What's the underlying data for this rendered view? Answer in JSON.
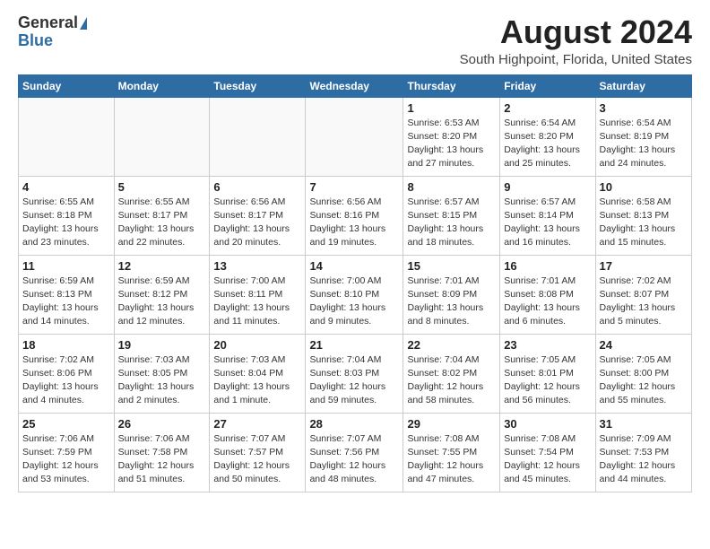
{
  "header": {
    "logo_general": "General",
    "logo_blue": "Blue",
    "title": "August 2024",
    "subtitle": "South Highpoint, Florida, United States"
  },
  "days_of_week": [
    "Sunday",
    "Monday",
    "Tuesday",
    "Wednesday",
    "Thursday",
    "Friday",
    "Saturday"
  ],
  "weeks": [
    [
      {
        "day": "",
        "info": ""
      },
      {
        "day": "",
        "info": ""
      },
      {
        "day": "",
        "info": ""
      },
      {
        "day": "",
        "info": ""
      },
      {
        "day": "1",
        "info": "Sunrise: 6:53 AM\nSunset: 8:20 PM\nDaylight: 13 hours\nand 27 minutes."
      },
      {
        "day": "2",
        "info": "Sunrise: 6:54 AM\nSunset: 8:20 PM\nDaylight: 13 hours\nand 25 minutes."
      },
      {
        "day": "3",
        "info": "Sunrise: 6:54 AM\nSunset: 8:19 PM\nDaylight: 13 hours\nand 24 minutes."
      }
    ],
    [
      {
        "day": "4",
        "info": "Sunrise: 6:55 AM\nSunset: 8:18 PM\nDaylight: 13 hours\nand 23 minutes."
      },
      {
        "day": "5",
        "info": "Sunrise: 6:55 AM\nSunset: 8:17 PM\nDaylight: 13 hours\nand 22 minutes."
      },
      {
        "day": "6",
        "info": "Sunrise: 6:56 AM\nSunset: 8:17 PM\nDaylight: 13 hours\nand 20 minutes."
      },
      {
        "day": "7",
        "info": "Sunrise: 6:56 AM\nSunset: 8:16 PM\nDaylight: 13 hours\nand 19 minutes."
      },
      {
        "day": "8",
        "info": "Sunrise: 6:57 AM\nSunset: 8:15 PM\nDaylight: 13 hours\nand 18 minutes."
      },
      {
        "day": "9",
        "info": "Sunrise: 6:57 AM\nSunset: 8:14 PM\nDaylight: 13 hours\nand 16 minutes."
      },
      {
        "day": "10",
        "info": "Sunrise: 6:58 AM\nSunset: 8:13 PM\nDaylight: 13 hours\nand 15 minutes."
      }
    ],
    [
      {
        "day": "11",
        "info": "Sunrise: 6:59 AM\nSunset: 8:13 PM\nDaylight: 13 hours\nand 14 minutes."
      },
      {
        "day": "12",
        "info": "Sunrise: 6:59 AM\nSunset: 8:12 PM\nDaylight: 13 hours\nand 12 minutes."
      },
      {
        "day": "13",
        "info": "Sunrise: 7:00 AM\nSunset: 8:11 PM\nDaylight: 13 hours\nand 11 minutes."
      },
      {
        "day": "14",
        "info": "Sunrise: 7:00 AM\nSunset: 8:10 PM\nDaylight: 13 hours\nand 9 minutes."
      },
      {
        "day": "15",
        "info": "Sunrise: 7:01 AM\nSunset: 8:09 PM\nDaylight: 13 hours\nand 8 minutes."
      },
      {
        "day": "16",
        "info": "Sunrise: 7:01 AM\nSunset: 8:08 PM\nDaylight: 13 hours\nand 6 minutes."
      },
      {
        "day": "17",
        "info": "Sunrise: 7:02 AM\nSunset: 8:07 PM\nDaylight: 13 hours\nand 5 minutes."
      }
    ],
    [
      {
        "day": "18",
        "info": "Sunrise: 7:02 AM\nSunset: 8:06 PM\nDaylight: 13 hours\nand 4 minutes."
      },
      {
        "day": "19",
        "info": "Sunrise: 7:03 AM\nSunset: 8:05 PM\nDaylight: 13 hours\nand 2 minutes."
      },
      {
        "day": "20",
        "info": "Sunrise: 7:03 AM\nSunset: 8:04 PM\nDaylight: 13 hours\nand 1 minute."
      },
      {
        "day": "21",
        "info": "Sunrise: 7:04 AM\nSunset: 8:03 PM\nDaylight: 12 hours\nand 59 minutes."
      },
      {
        "day": "22",
        "info": "Sunrise: 7:04 AM\nSunset: 8:02 PM\nDaylight: 12 hours\nand 58 minutes."
      },
      {
        "day": "23",
        "info": "Sunrise: 7:05 AM\nSunset: 8:01 PM\nDaylight: 12 hours\nand 56 minutes."
      },
      {
        "day": "24",
        "info": "Sunrise: 7:05 AM\nSunset: 8:00 PM\nDaylight: 12 hours\nand 55 minutes."
      }
    ],
    [
      {
        "day": "25",
        "info": "Sunrise: 7:06 AM\nSunset: 7:59 PM\nDaylight: 12 hours\nand 53 minutes."
      },
      {
        "day": "26",
        "info": "Sunrise: 7:06 AM\nSunset: 7:58 PM\nDaylight: 12 hours\nand 51 minutes."
      },
      {
        "day": "27",
        "info": "Sunrise: 7:07 AM\nSunset: 7:57 PM\nDaylight: 12 hours\nand 50 minutes."
      },
      {
        "day": "28",
        "info": "Sunrise: 7:07 AM\nSunset: 7:56 PM\nDaylight: 12 hours\nand 48 minutes."
      },
      {
        "day": "29",
        "info": "Sunrise: 7:08 AM\nSunset: 7:55 PM\nDaylight: 12 hours\nand 47 minutes."
      },
      {
        "day": "30",
        "info": "Sunrise: 7:08 AM\nSunset: 7:54 PM\nDaylight: 12 hours\nand 45 minutes."
      },
      {
        "day": "31",
        "info": "Sunrise: 7:09 AM\nSunset: 7:53 PM\nDaylight: 12 hours\nand 44 minutes."
      }
    ]
  ]
}
